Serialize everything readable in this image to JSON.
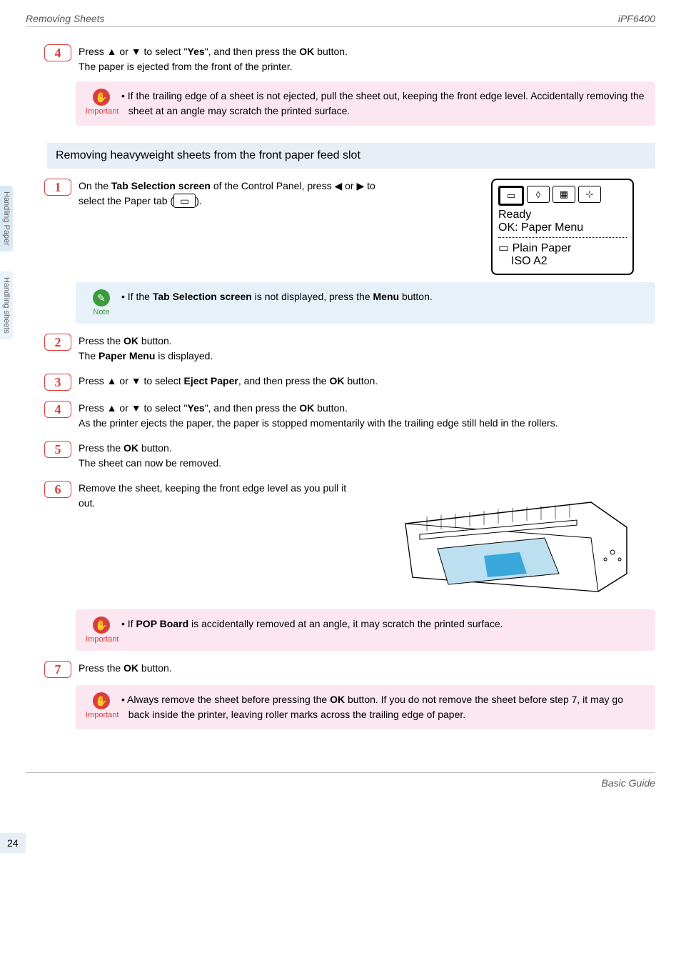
{
  "header": {
    "left": "Removing Sheets",
    "right": "iPF6400"
  },
  "sidebar": {
    "tab1": "Handling Paper",
    "tab2": "Handling sheets"
  },
  "step4a": {
    "num": "4",
    "l1_pre": "Press ▲ or ▼ to select \"",
    "l1_b": "Yes",
    "l1_mid": "\", and then press the ",
    "l1_b2": "OK",
    "l1_end": " button.",
    "l2": "The paper is ejected from the front of the printer."
  },
  "imp1": {
    "label": "Important",
    "text": "If the trailing edge of a sheet is not ejected, pull the sheet out, keeping the front edge level. Accidentally removing the sheet at an angle may scratch the printed surface."
  },
  "section": "Removing heavyweight sheets from the front paper feed slot",
  "step1": {
    "num": "1",
    "pre": "On the ",
    "b1": "Tab Selection screen",
    "mid": " of the Control Panel, press ◀ or ▶ to select the Paper tab (",
    "tabicon": "▭",
    "end": ")."
  },
  "lcd": {
    "tabs": [
      "▭",
      "◊",
      "▦",
      "⊹"
    ],
    "line1": "Ready",
    "line2": "OK: Paper Menu",
    "line3_icon": "▭",
    "line3": "Plain Paper",
    "line4": "ISO A2"
  },
  "note1": {
    "label": "Note",
    "pre": "If the ",
    "b": "Tab Selection screen",
    "mid": " is not displayed, press the ",
    "b2": "Menu",
    "end": " button."
  },
  "step2": {
    "num": "2",
    "pre": "Press the ",
    "b": "OK",
    "mid": " button.",
    "l2_pre": "The ",
    "l2_b": "Paper Menu",
    "l2_end": " is displayed."
  },
  "step3": {
    "num": "3",
    "pre": "Press ▲ or ▼ to select ",
    "b": "Eject Paper",
    "mid": ", and then press the ",
    "b2": "OK",
    "end": " button."
  },
  "step4b": {
    "num": "4",
    "pre": "Press ▲ or ▼ to select \"",
    "b": "Yes",
    "mid": "\", and then press the ",
    "b2": "OK",
    "end": " button.",
    "l2": "As the printer ejects the paper, the paper is stopped momentarily with the trailing edge still held in the rollers."
  },
  "step5": {
    "num": "5",
    "pre": "Press the ",
    "b": "OK",
    "end": " button.",
    "l2": "The sheet can now be removed."
  },
  "step6": {
    "num": "6",
    "text": "Remove the sheet, keeping the front edge level as you pull it out."
  },
  "imp2": {
    "label": "Important",
    "pre": "If ",
    "b": "POP Board",
    "end": " is accidentally removed at an angle, it may scratch the printed surface."
  },
  "step7": {
    "num": "7",
    "pre": "Press the ",
    "b": "OK",
    "end": " button."
  },
  "imp3": {
    "label": "Important",
    "pre": "Always remove the sheet before pressing the ",
    "b": "OK",
    "end": " button. If you do not remove the sheet before step 7, it may go back inside the printer, leaving roller marks across the trailing edge of paper."
  },
  "pagenum": "24",
  "footer": "Basic Guide"
}
